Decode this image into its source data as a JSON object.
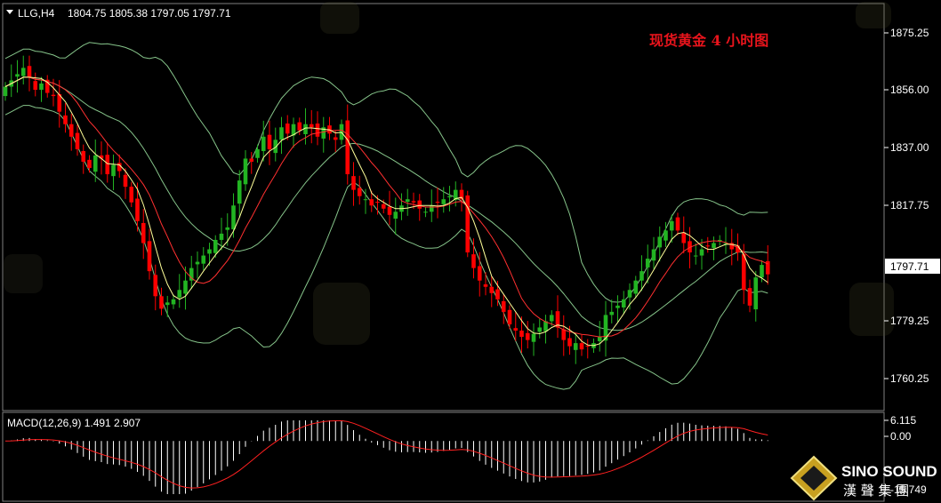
{
  "header": {
    "symbol_timeframe": "LLG,H4",
    "ohlc": "1804.75 1805.38 1797.05 1797.71"
  },
  "chart_title": "现货黄金 4 小时图",
  "price_axis": {
    "ticks": [
      "1875.25",
      "1856.00",
      "1837.00",
      "1817.75",
      "1779.25",
      "1760.25"
    ],
    "current_price": "1797.71"
  },
  "macd": {
    "label": "MACD(12,26,9) 1.491 2.907",
    "ticks": [
      "6.115",
      "0.00",
      "-15.749"
    ]
  },
  "logo": {
    "brand": "SINO SOUND",
    "brand_cn": "漢 聲 集 團"
  },
  "colors": {
    "up": "#22b422",
    "down": "#ff0000",
    "bollinger": "#86c48a",
    "ma_fast": "#ffff99",
    "ma_slow": "#ff3030",
    "macd_hist": "#ffffff",
    "macd_signal": "#ff2020",
    "accent_title": "#e8141c"
  },
  "chart_data": {
    "type": "candlestick",
    "price_range": [
      1755,
      1884
    ],
    "close_series": [
      1858,
      1860,
      1862,
      1864,
      1861,
      1857,
      1859,
      1856,
      1855,
      1850,
      1846,
      1842,
      1838,
      1834,
      1832,
      1836,
      1835,
      1830,
      1833,
      1831,
      1826,
      1821,
      1815,
      1808,
      1799,
      1791,
      1787,
      1789,
      1790,
      1793,
      1796,
      1800,
      1802,
      1804,
      1806,
      1809,
      1811,
      1813,
      1820,
      1828,
      1835,
      1834,
      1838,
      1842,
      1838,
      1841,
      1845,
      1843,
      1846,
      1844,
      1846,
      1845,
      1842,
      1845,
      1843,
      1841,
      1846,
      1830,
      1825,
      1823,
      1822,
      1820,
      1821,
      1819,
      1817,
      1818,
      1820,
      1822,
      1821,
      1819,
      1818,
      1820,
      1821,
      1822,
      1823,
      1825,
      1822,
      1805,
      1800,
      1796,
      1794,
      1792,
      1790,
      1786,
      1782,
      1780,
      1778,
      1777,
      1779,
      1781,
      1783,
      1785,
      1781,
      1777,
      1775,
      1776,
      1774,
      1775,
      1776,
      1778,
      1785,
      1786,
      1788,
      1790,
      1793,
      1796,
      1799,
      1803,
      1806,
      1810,
      1812,
      1815,
      1812,
      1808,
      1805,
      1804,
      1806,
      1807,
      1808,
      1809,
      1808,
      1806,
      1805,
      1793,
      1788,
      1797,
      1801,
      1798
    ],
    "bollinger": {
      "upper_start": 1868,
      "upper_peak": 1880,
      "upper_end": 1820,
      "lower_start": 1852,
      "lower_trough": 1765,
      "lower_end": 1783
    },
    "macd": {
      "range": [
        -15.749,
        6.115
      ],
      "main": 1.491,
      "signal": 2.907
    }
  }
}
